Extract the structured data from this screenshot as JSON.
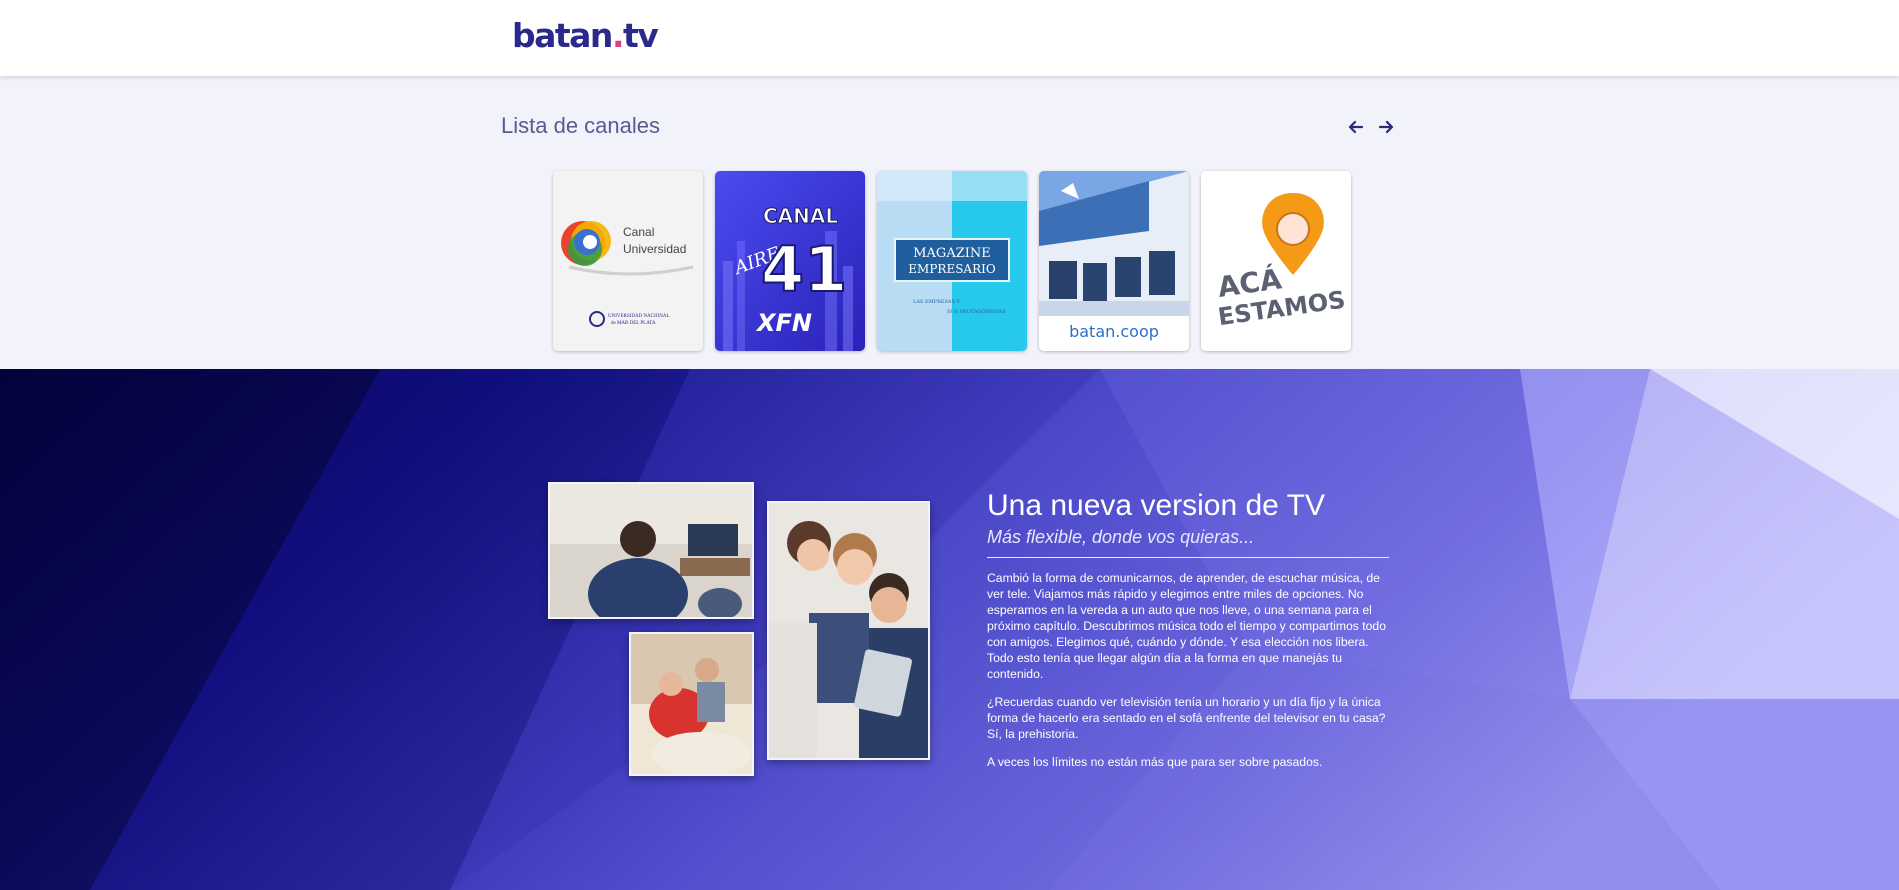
{
  "header": {
    "logo_main": "batan",
    "logo_dot": ".",
    "logo_tld": "tv",
    "logo_color": "#2a2a8c"
  },
  "channels": {
    "title": "Lista de canales",
    "prev_icon": "arrow-left-icon",
    "next_icon": "arrow-right-icon",
    "items": [
      {
        "name": "canal-universidad",
        "line1": "Canal",
        "line2": "Universidad",
        "footer1": "UNIVERSIDAD NACIONAL",
        "footer2": "de MAR DEL PLATA"
      },
      {
        "name": "canal-41",
        "top": "CANAL",
        "script": "AIRE",
        "number": "41",
        "brand": "XFN"
      },
      {
        "name": "magazine-empresario",
        "line1": "MAGAZINE",
        "line2": "EMPRESARIO",
        "sub1": "LAS EMPRESAS Y",
        "sub2": "SUS PROTAGONISTAS"
      },
      {
        "name": "batan-coop",
        "label": "batan.coop"
      },
      {
        "name": "aca-estamos",
        "line1": "ACÁ",
        "line2": "ESTAMOS"
      }
    ]
  },
  "hero": {
    "title": "Una nueva version de TV",
    "subtitle": "Más flexible, donde vos quieras...",
    "paragraphs": [
      "Cambió la forma de comunicarnos, de aprender, de escuchar música, de ver tele. Viajamos más rápido y elegimos entre miles de opciones. No esperamos en la vereda a un auto que nos lleve, o una semana para el próximo capítulo. Descubrimos música todo el tiempo y compartimos todo con amigos. Elegimos qué, cuándo y dónde. Y esa elección nos libera. Todo esto tenía que llegar algún día a la forma en que manejás tu contenido.",
      "¿Recuerdas cuando ver televisión tenía un horario y un día fijo y la única forma de hacerlo era sentado en el sofá enfrente del televisor en tu casa? Sí, la prehistoria.",
      "A veces los límites no están más que para ser sobre pasados."
    ],
    "colors": {
      "dark": "#05044a",
      "mid": "#3a3ab8",
      "light": "#7a7ae6"
    }
  }
}
